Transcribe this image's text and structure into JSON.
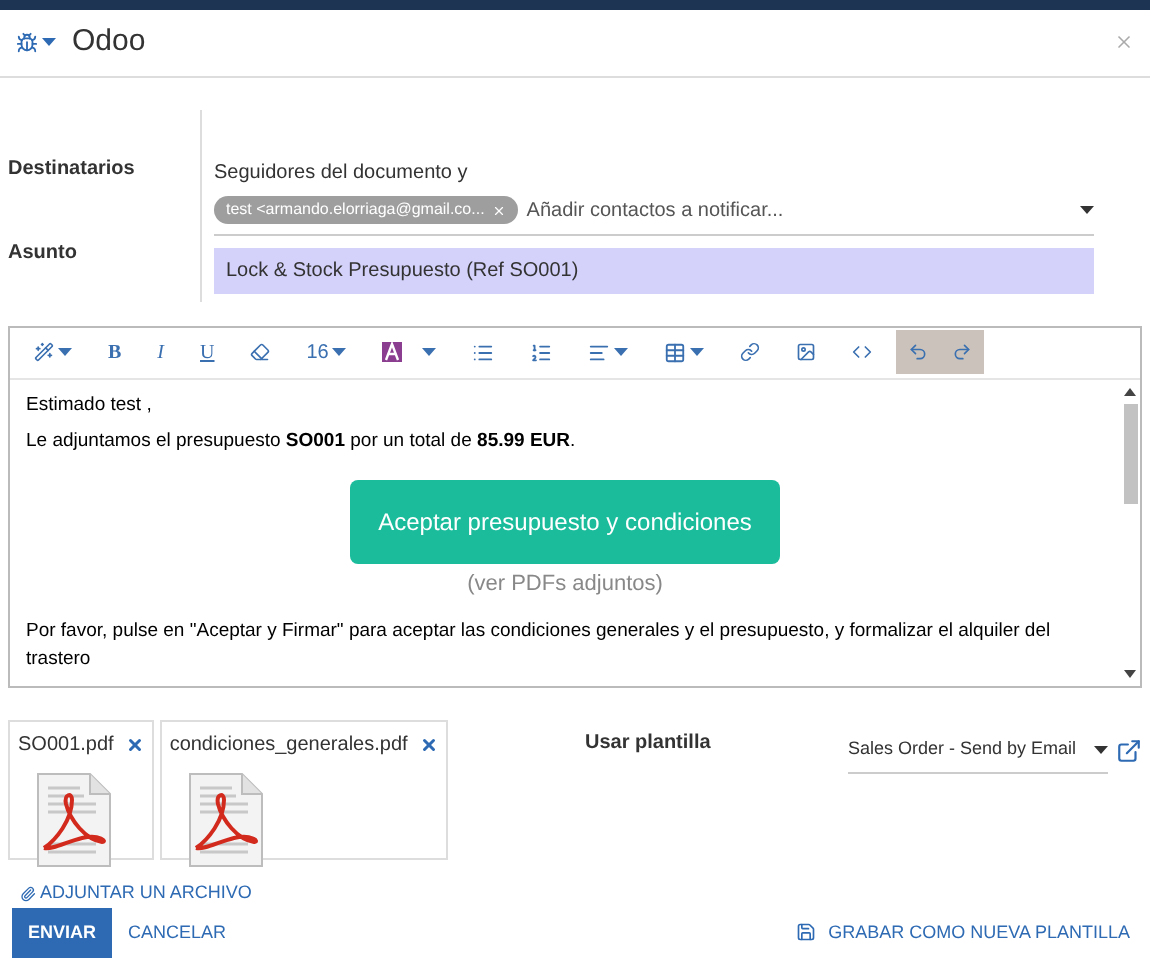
{
  "window": {
    "title": "Odoo"
  },
  "recipients": {
    "label": "Destinatarios",
    "note": "Seguidores del documento y",
    "tags": [
      {
        "text": "test <armando.elorriaga@gmail.co..."
      }
    ],
    "placeholder": "Añadir contactos a notificar..."
  },
  "subject": {
    "label": "Asunto",
    "value": "Lock & Stock Presupuesto (Ref SO001)"
  },
  "toolbar": {
    "bold": "B",
    "italic": "I",
    "underline": "U",
    "font_size": "16"
  },
  "body": {
    "greeting": "Estimado test ,",
    "line": "Le adjuntamos el presupuesto **SO001** por un total de **85.99 EUR**.",
    "cta": "Aceptar presupuesto y condiciones",
    "cta_note": "(ver PDFs adjuntos)",
    "paragraph": "Por favor, pulse en \"Aceptar y Firmar\" para aceptar las condiciones generales y el presupuesto, y formalizar el alquiler del trastero"
  },
  "attachments": [
    {
      "name": "SO001.pdf"
    },
    {
      "name": "condiciones_generales.pdf"
    }
  ],
  "attach_link": "ADJUNTAR UN ARCHIVO",
  "template": {
    "label": "Usar plantilla",
    "value": "Sales Order - Send by Email"
  },
  "buttons": {
    "send": "ENVIAR",
    "cancel": "CANCELAR",
    "save_template": "GRABAR COMO NUEVA PLANTILLA"
  }
}
